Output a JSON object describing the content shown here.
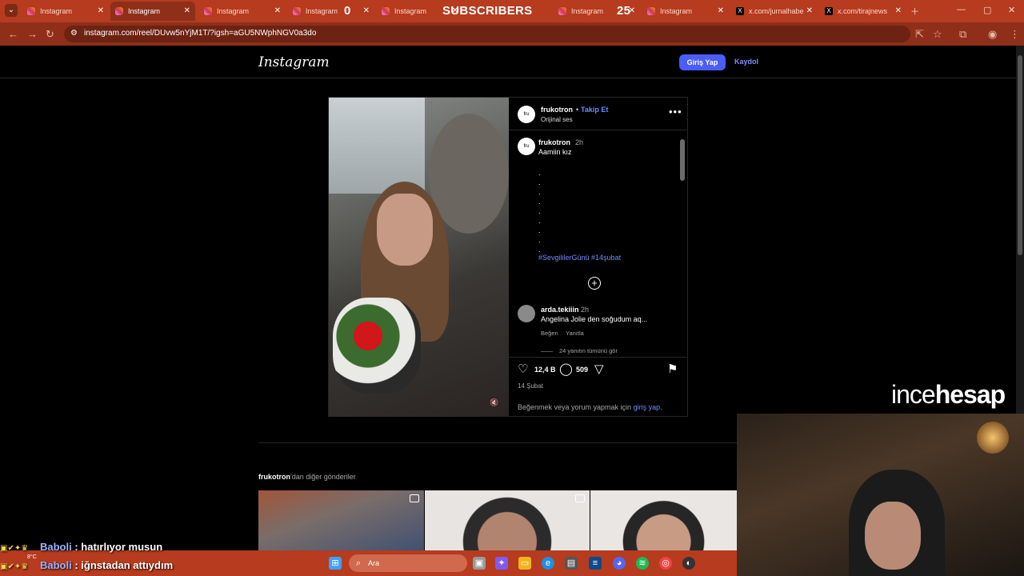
{
  "browser": {
    "tabs": [
      {
        "label": "Instagram",
        "icon": "instagram-icon"
      },
      {
        "label": "Instagram",
        "icon": "instagram-icon",
        "active": true
      },
      {
        "label": "Instagram",
        "icon": "instagram-icon"
      },
      {
        "label": "Instagram",
        "icon": "instagram-icon"
      },
      {
        "label": "Instagram",
        "icon": "instagram-icon"
      },
      {
        "label": "Instagram",
        "icon": "instagram-icon"
      },
      {
        "label": "Instagram",
        "icon": "instagram-icon"
      },
      {
        "label": "x.com/jurnalhabe",
        "icon": "x-icon"
      },
      {
        "label": "x.com/tirajnews",
        "icon": "x-icon"
      }
    ],
    "overlay": {
      "left_count": "0",
      "center": "SUBSCRIBERS",
      "right_count": "25"
    },
    "url": "instagram.com/reel/DUvw5nYjM1T/?igsh=aGU5NWphNGV0a3do",
    "theme_color": "#b63b1f"
  },
  "ig": {
    "logo": "Instagram",
    "login_label": "Giriş Yap",
    "signup_label": "Kaydol"
  },
  "post": {
    "author": "frukotron",
    "separator": "•",
    "follow_label": "Takip Et",
    "audio": "Orijinal ses",
    "avatar_text": "fru",
    "caption_author": "frukotron",
    "caption_time": "2h",
    "caption": "Aamiin kız",
    "caption_dots": ".\n.\n.\n.\n.\n.\n.\n.\n.",
    "hashtags": "#SevgililerGünü #14şubat",
    "comment": {
      "author": "arda.tekiiin",
      "time": "2h",
      "text": "Angelina Jolie den soğudum aq...",
      "like_label": "Beğen",
      "reply_label": "Yanıtla",
      "replies_label": "24 yanıtın tümünü gör"
    },
    "likes": "12,4 B",
    "comments_count": "509",
    "date": "14 Şubat",
    "login_prompt": "Beğenmek veya yorum yapmak için",
    "login_link": "giriş yap",
    "login_suffix": "."
  },
  "more_posts": {
    "author": "frukotron",
    "suffix": "'dan diğer gönderiler"
  },
  "stream": {
    "brand_light": "ince",
    "brand_bold": "hesap",
    "chat": [
      {
        "user": "Baboli",
        "message": " : hatırlıyor musun"
      },
      {
        "user": "Baboli",
        "message": " : iğnstadan attıydım"
      }
    ],
    "weather": "8°C"
  },
  "taskbar": {
    "search_placeholder": "Ara"
  }
}
